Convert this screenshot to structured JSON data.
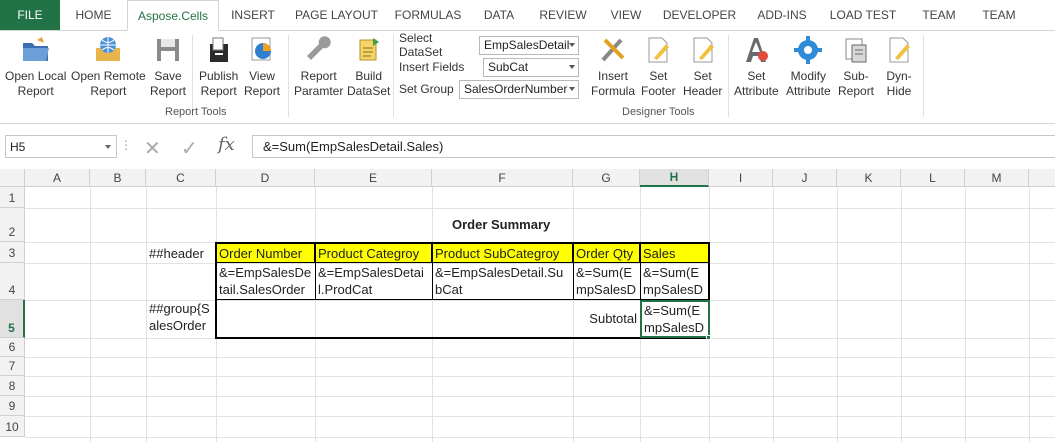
{
  "tabs": [
    "FILE",
    "HOME",
    "Aspose.Cells",
    "INSERT",
    "PAGE LAYOUT",
    "FORMULAS",
    "DATA",
    "REVIEW",
    "VIEW",
    "DEVELOPER",
    "ADD-INS",
    "LOAD TEST",
    "TEAM",
    "TEAM"
  ],
  "ribbon": {
    "open_local": [
      "Open Local",
      "Report"
    ],
    "open_remote": [
      "Open Remote",
      "Report"
    ],
    "save": [
      "Save",
      "Report"
    ],
    "publish": [
      "Publish",
      "Report"
    ],
    "view": [
      "View",
      "Report"
    ],
    "report_param": [
      "Report",
      "Paramter"
    ],
    "build_dataset": [
      "Build",
      "DataSet"
    ],
    "report_tools_label": "Report Tools",
    "select_dataset_label": "Select DataSet",
    "select_dataset_value": "EmpSalesDetail",
    "insert_fields_label": "Insert Fields",
    "insert_fields_value": "SubCat",
    "set_group_label": "Set Group",
    "set_group_value": "SalesOrderNumber",
    "insert_formula": [
      "Insert",
      "Formula"
    ],
    "set_footer": [
      "Set",
      "Footer"
    ],
    "set_header": [
      "Set",
      "Header"
    ],
    "set_attribute": [
      "Set",
      "Attribute"
    ],
    "modify_attribute": [
      "Modify",
      "Attribute"
    ],
    "sub_report": [
      "Sub-",
      "Report"
    ],
    "dyn_hide": [
      "Dyn-",
      "Hide"
    ],
    "designer_tools_label": "Designer Tools"
  },
  "formula_bar": {
    "name_box": "H5",
    "dots": "⋮",
    "fx": "fx",
    "formula": "&=Sum(EmpSalesDetail.Sales)"
  },
  "columns": [
    "A",
    "B",
    "C",
    "D",
    "E",
    "F",
    "G",
    "H",
    "I",
    "J",
    "K",
    "L",
    "M"
  ],
  "rows": [
    "1",
    "2",
    "3",
    "4",
    "5",
    "6",
    "7",
    "8",
    "9",
    "10"
  ],
  "cells": {
    "title": "Order  Summary",
    "c3": "##header",
    "d3": "Order Number",
    "e3": "Product Categroy",
    "f3": "Product SubCategroy",
    "g3": "Order Qty",
    "h3": "Sales",
    "d4": [
      "&=EmpSalesDe",
      "tail.SalesOrder"
    ],
    "e4": [
      "&=EmpSalesDetai",
      "l.ProdCat"
    ],
    "f4": [
      "&=EmpSalesDetail.Su",
      "bCat"
    ],
    "g4": [
      "&=Sum(E",
      "mpSalesD"
    ],
    "h4": [
      "&=Sum(E",
      "mpSalesD"
    ],
    "c5": [
      "##group{S",
      "alesOrder"
    ],
    "g5": "Subtotal",
    "h5": [
      "&=Sum(E",
      "mpSalesD"
    ]
  }
}
